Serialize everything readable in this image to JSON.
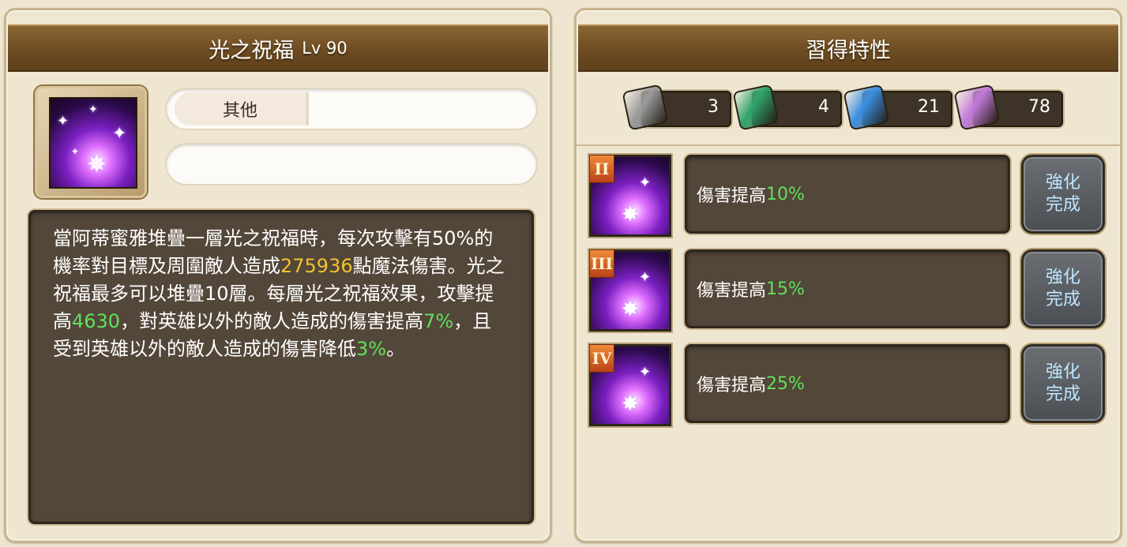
{
  "left_panel": {
    "title": "光之祝福",
    "level": "Lv 90",
    "category_tag": "其他",
    "description": [
      {
        "t": "當阿蒂蜜雅堆疊一層光之祝福時，每次攻擊有"
      },
      {
        "t": "50%的機率對目標及周圍敵人造成"
      },
      {
        "t": "275936",
        "c": "yel"
      },
      {
        "t": "點魔法傷害。光之祝福最多可以堆疊10層。每層光之祝福效果，攻擊提高"
      },
      {
        "t": "4630",
        "c": "grn"
      },
      {
        "t": "，對英雄以外的敵人造成的傷害提高"
      },
      {
        "t": "7%",
        "c": "grn"
      },
      {
        "t": "，且受到英雄以外的敵人造成的傷害降低"
      },
      {
        "t": "3%",
        "c": "grn"
      },
      {
        "t": "。"
      }
    ]
  },
  "right_panel": {
    "title": "習得特性",
    "currencies": [
      {
        "icon": "gray-rune-book-icon",
        "value": "3",
        "color": "#9a9a9a"
      },
      {
        "icon": "green-rune-book-icon",
        "value": "4",
        "color": "#2fa36a"
      },
      {
        "icon": "blue-rune-book-icon",
        "value": "21",
        "color": "#3a8fe0"
      },
      {
        "icon": "purple-rune-book-icon",
        "value": "78",
        "color": "#c27ad8"
      }
    ],
    "traits": [
      {
        "rank": "II",
        "text": "傷害提高",
        "value": "10%",
        "button": [
          "強化",
          "完成"
        ]
      },
      {
        "rank": "III",
        "text": "傷害提高",
        "value": "15%",
        "button": [
          "強化",
          "完成"
        ]
      },
      {
        "rank": "IV",
        "text": "傷害提高",
        "value": "25%",
        "button": [
          "強化",
          "完成"
        ]
      }
    ]
  }
}
